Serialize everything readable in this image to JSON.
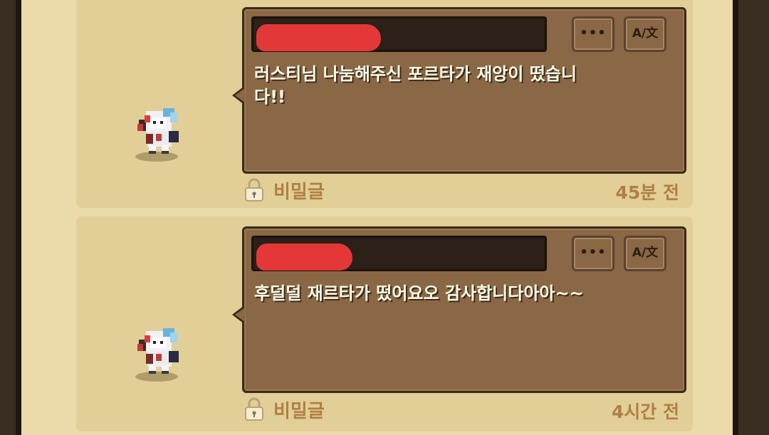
{
  "posts": [
    {
      "message": "러스티님 나눔해주신 포르타가 재앙이 떴습니다!!",
      "more_label": "•••",
      "translate_label": "A/文",
      "privacy_label": "비밀글",
      "time": "45분 전"
    },
    {
      "message": "후덜덜 재르타가 떴어요오 감사합니다아아~~",
      "more_label": "•••",
      "translate_label": "A/文",
      "privacy_label": "비밀글",
      "time": "4시간 전"
    }
  ],
  "colors": {
    "board": "#ebdba9",
    "card": "#e1cf97",
    "bubble": "#8a6745",
    "name_bar": "#2c2018",
    "redaction": "#ee3a3a",
    "meta_text": "#b07f45"
  }
}
